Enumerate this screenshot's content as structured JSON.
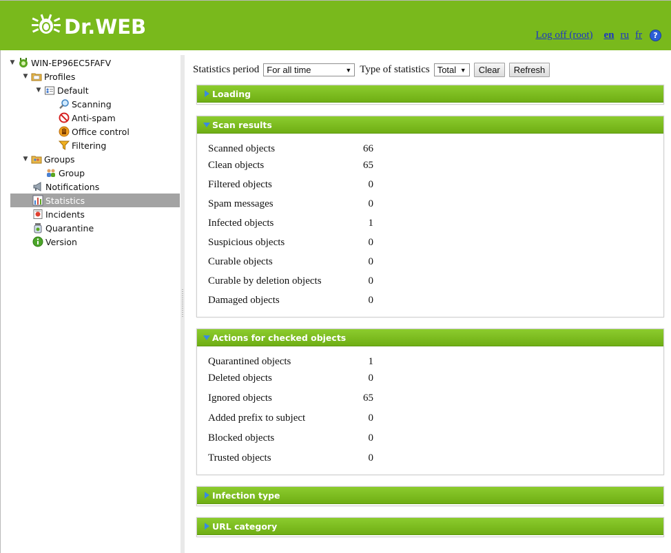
{
  "header": {
    "logo_text": "Dr.WEB",
    "logoff_label": "Log off (root)",
    "languages": [
      "en",
      "ru",
      "fr"
    ],
    "help_symbol": "?",
    "brand_color": "#79b91c"
  },
  "tree": {
    "root": "WIN-EP96EC5FAFV",
    "profiles": "Profiles",
    "default": "Default",
    "scanning": "Scanning",
    "antispam": "Anti-spam",
    "office_control": "Office control",
    "filtering": "Filtering",
    "groups": "Groups",
    "group": "Group",
    "notifications": "Notifications",
    "statistics": "Statistics",
    "incidents": "Incidents",
    "quarantine": "Quarantine",
    "version": "Version"
  },
  "toolbar": {
    "period_label": "Statistics period",
    "period_value": "For all time",
    "type_label": "Type of statistics",
    "type_value": "Total",
    "clear_label": "Clear",
    "refresh_label": "Refresh"
  },
  "panels": {
    "loading": {
      "title": "Loading",
      "expanded": false
    },
    "scan_results": {
      "title": "Scan results",
      "expanded": true,
      "rows": [
        {
          "label": "Scanned objects",
          "value": "66"
        },
        {
          "label": "Clean objects",
          "value": "65"
        },
        {
          "label": "Filtered objects",
          "value": "0"
        },
        {
          "label": "Spam messages",
          "value": "0"
        },
        {
          "label": "Infected objects",
          "value": "1"
        },
        {
          "label": "Suspicious objects",
          "value": "0"
        },
        {
          "label": "Curable objects",
          "value": "0"
        },
        {
          "label": "Curable by deletion objects",
          "value": "0"
        },
        {
          "label": "Damaged objects",
          "value": "0"
        }
      ]
    },
    "actions": {
      "title": "Actions for checked objects",
      "expanded": true,
      "rows": [
        {
          "label": "Quarantined objects",
          "value": "1"
        },
        {
          "label": "Deleted objects",
          "value": "0"
        },
        {
          "label": "Ignored objects",
          "value": "65"
        },
        {
          "label": "Added prefix to subject",
          "value": "0"
        },
        {
          "label": "Blocked objects",
          "value": "0"
        },
        {
          "label": "Trusted objects",
          "value": "0"
        }
      ]
    },
    "infection_type": {
      "title": "Infection type",
      "expanded": false
    },
    "url_category": {
      "title": "URL category",
      "expanded": false
    }
  }
}
